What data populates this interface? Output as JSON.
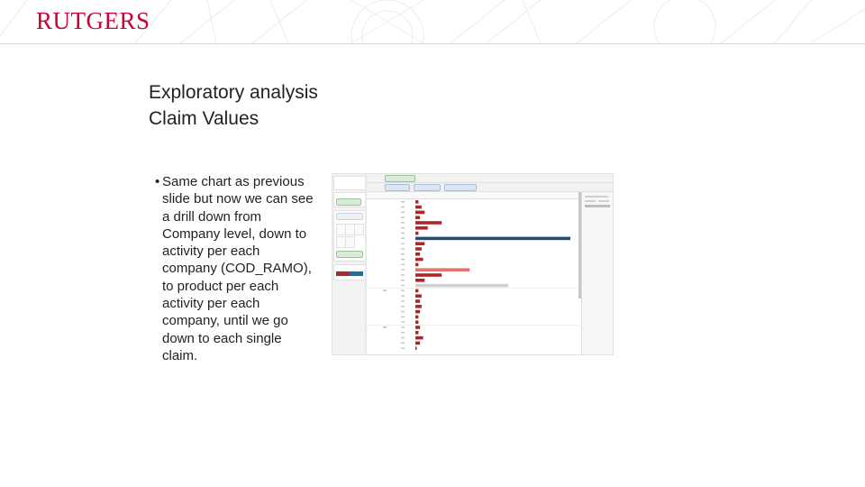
{
  "header": {
    "logo_text": "RUTGERS",
    "brand_color": "#cc0033"
  },
  "title": {
    "line1": "Exploratory analysis",
    "line2": "Claim Values"
  },
  "bullet": {
    "symbol": "•",
    "lines": [
      "Same chart as previous",
      "slide but now we can see",
      "a drill down from",
      "Company level, down to",
      "activity per each",
      "company (COD_RAMO),",
      "to product per each",
      "activity per each",
      "company, until we go",
      "down to each single",
      "claim."
    ]
  },
  "screenshot": {
    "description_icon": "tableau-worksheet-image",
    "bar_colors": {
      "dark_red": "#b22428",
      "navy": "#1f4e79",
      "salmon": "#e0736a",
      "gray": "#cfcfcf"
    },
    "bars": [
      {
        "value": 0.02,
        "color": "dark_red"
      },
      {
        "value": 0.04,
        "color": "dark_red"
      },
      {
        "value": 0.06,
        "color": "dark_red"
      },
      {
        "value": 0.03,
        "color": "dark_red"
      },
      {
        "value": 0.17,
        "color": "dark_red"
      },
      {
        "value": 0.08,
        "color": "dark_red"
      },
      {
        "value": 0.02,
        "color": "dark_red"
      },
      {
        "value": 1.0,
        "color": "navy"
      },
      {
        "value": 0.06,
        "color": "dark_red"
      },
      {
        "value": 0.04,
        "color": "dark_red"
      },
      {
        "value": 0.03,
        "color": "dark_red"
      },
      {
        "value": 0.05,
        "color": "dark_red"
      },
      {
        "value": 0.02,
        "color": "dark_red"
      },
      {
        "value": 0.35,
        "color": "salmon"
      },
      {
        "value": 0.17,
        "color": "dark_red"
      },
      {
        "value": 0.06,
        "color": "dark_red"
      },
      {
        "value": 0.6,
        "color": "gray"
      },
      {
        "value": 0.02,
        "color": "dark_red"
      },
      {
        "value": 0.04,
        "color": "dark_red"
      },
      {
        "value": 0.03,
        "color": "dark_red"
      },
      {
        "value": 0.04,
        "color": "dark_red"
      },
      {
        "value": 0.03,
        "color": "dark_red"
      },
      {
        "value": 0.02,
        "color": "dark_red"
      },
      {
        "value": 0.02,
        "color": "dark_red"
      },
      {
        "value": 0.03,
        "color": "dark_red"
      },
      {
        "value": 0.02,
        "color": "dark_red"
      },
      {
        "value": 0.05,
        "color": "dark_red"
      },
      {
        "value": 0.03,
        "color": "dark_red"
      },
      {
        "value": 0.0,
        "color": "dark_red"
      }
    ]
  }
}
